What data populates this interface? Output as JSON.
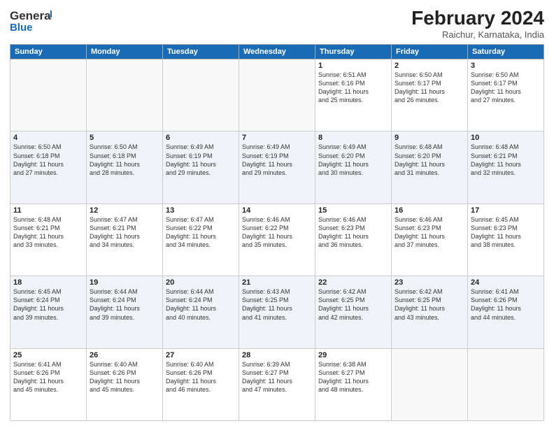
{
  "header": {
    "logo_general": "General",
    "logo_blue": "Blue",
    "title": "February 2024",
    "location": "Raichur, Karnataka, India"
  },
  "days_of_week": [
    "Sunday",
    "Monday",
    "Tuesday",
    "Wednesday",
    "Thursday",
    "Friday",
    "Saturday"
  ],
  "weeks": [
    [
      {
        "num": "",
        "empty": true
      },
      {
        "num": "",
        "empty": true
      },
      {
        "num": "",
        "empty": true
      },
      {
        "num": "",
        "empty": true
      },
      {
        "num": "1",
        "info": "Sunrise: 6:51 AM\nSunset: 6:16 PM\nDaylight: 11 hours\nand 25 minutes."
      },
      {
        "num": "2",
        "info": "Sunrise: 6:50 AM\nSunset: 6:17 PM\nDaylight: 11 hours\nand 26 minutes."
      },
      {
        "num": "3",
        "info": "Sunrise: 6:50 AM\nSunset: 6:17 PM\nDaylight: 11 hours\nand 27 minutes."
      }
    ],
    [
      {
        "num": "4",
        "info": "Sunrise: 6:50 AM\nSunset: 6:18 PM\nDaylight: 11 hours\nand 27 minutes."
      },
      {
        "num": "5",
        "info": "Sunrise: 6:50 AM\nSunset: 6:18 PM\nDaylight: 11 hours\nand 28 minutes."
      },
      {
        "num": "6",
        "info": "Sunrise: 6:49 AM\nSunset: 6:19 PM\nDaylight: 11 hours\nand 29 minutes."
      },
      {
        "num": "7",
        "info": "Sunrise: 6:49 AM\nSunset: 6:19 PM\nDaylight: 11 hours\nand 29 minutes."
      },
      {
        "num": "8",
        "info": "Sunrise: 6:49 AM\nSunset: 6:20 PM\nDaylight: 11 hours\nand 30 minutes."
      },
      {
        "num": "9",
        "info": "Sunrise: 6:48 AM\nSunset: 6:20 PM\nDaylight: 11 hours\nand 31 minutes."
      },
      {
        "num": "10",
        "info": "Sunrise: 6:48 AM\nSunset: 6:21 PM\nDaylight: 11 hours\nand 32 minutes."
      }
    ],
    [
      {
        "num": "11",
        "info": "Sunrise: 6:48 AM\nSunset: 6:21 PM\nDaylight: 11 hours\nand 33 minutes."
      },
      {
        "num": "12",
        "info": "Sunrise: 6:47 AM\nSunset: 6:21 PM\nDaylight: 11 hours\nand 34 minutes."
      },
      {
        "num": "13",
        "info": "Sunrise: 6:47 AM\nSunset: 6:22 PM\nDaylight: 11 hours\nand 34 minutes."
      },
      {
        "num": "14",
        "info": "Sunrise: 6:46 AM\nSunset: 6:22 PM\nDaylight: 11 hours\nand 35 minutes."
      },
      {
        "num": "15",
        "info": "Sunrise: 6:46 AM\nSunset: 6:23 PM\nDaylight: 11 hours\nand 36 minutes."
      },
      {
        "num": "16",
        "info": "Sunrise: 6:46 AM\nSunset: 6:23 PM\nDaylight: 11 hours\nand 37 minutes."
      },
      {
        "num": "17",
        "info": "Sunrise: 6:45 AM\nSunset: 6:23 PM\nDaylight: 11 hours\nand 38 minutes."
      }
    ],
    [
      {
        "num": "18",
        "info": "Sunrise: 6:45 AM\nSunset: 6:24 PM\nDaylight: 11 hours\nand 39 minutes."
      },
      {
        "num": "19",
        "info": "Sunrise: 6:44 AM\nSunset: 6:24 PM\nDaylight: 11 hours\nand 39 minutes."
      },
      {
        "num": "20",
        "info": "Sunrise: 6:44 AM\nSunset: 6:24 PM\nDaylight: 11 hours\nand 40 minutes."
      },
      {
        "num": "21",
        "info": "Sunrise: 6:43 AM\nSunset: 6:25 PM\nDaylight: 11 hours\nand 41 minutes."
      },
      {
        "num": "22",
        "info": "Sunrise: 6:42 AM\nSunset: 6:25 PM\nDaylight: 11 hours\nand 42 minutes."
      },
      {
        "num": "23",
        "info": "Sunrise: 6:42 AM\nSunset: 6:25 PM\nDaylight: 11 hours\nand 43 minutes."
      },
      {
        "num": "24",
        "info": "Sunrise: 6:41 AM\nSunset: 6:26 PM\nDaylight: 11 hours\nand 44 minutes."
      }
    ],
    [
      {
        "num": "25",
        "info": "Sunrise: 6:41 AM\nSunset: 6:26 PM\nDaylight: 11 hours\nand 45 minutes."
      },
      {
        "num": "26",
        "info": "Sunrise: 6:40 AM\nSunset: 6:26 PM\nDaylight: 11 hours\nand 45 minutes."
      },
      {
        "num": "27",
        "info": "Sunrise: 6:40 AM\nSunset: 6:26 PM\nDaylight: 11 hours\nand 46 minutes."
      },
      {
        "num": "28",
        "info": "Sunrise: 6:39 AM\nSunset: 6:27 PM\nDaylight: 11 hours\nand 47 minutes."
      },
      {
        "num": "29",
        "info": "Sunrise: 6:38 AM\nSunset: 6:27 PM\nDaylight: 11 hours\nand 48 minutes."
      },
      {
        "num": "",
        "empty": true
      },
      {
        "num": "",
        "empty": true
      }
    ]
  ]
}
